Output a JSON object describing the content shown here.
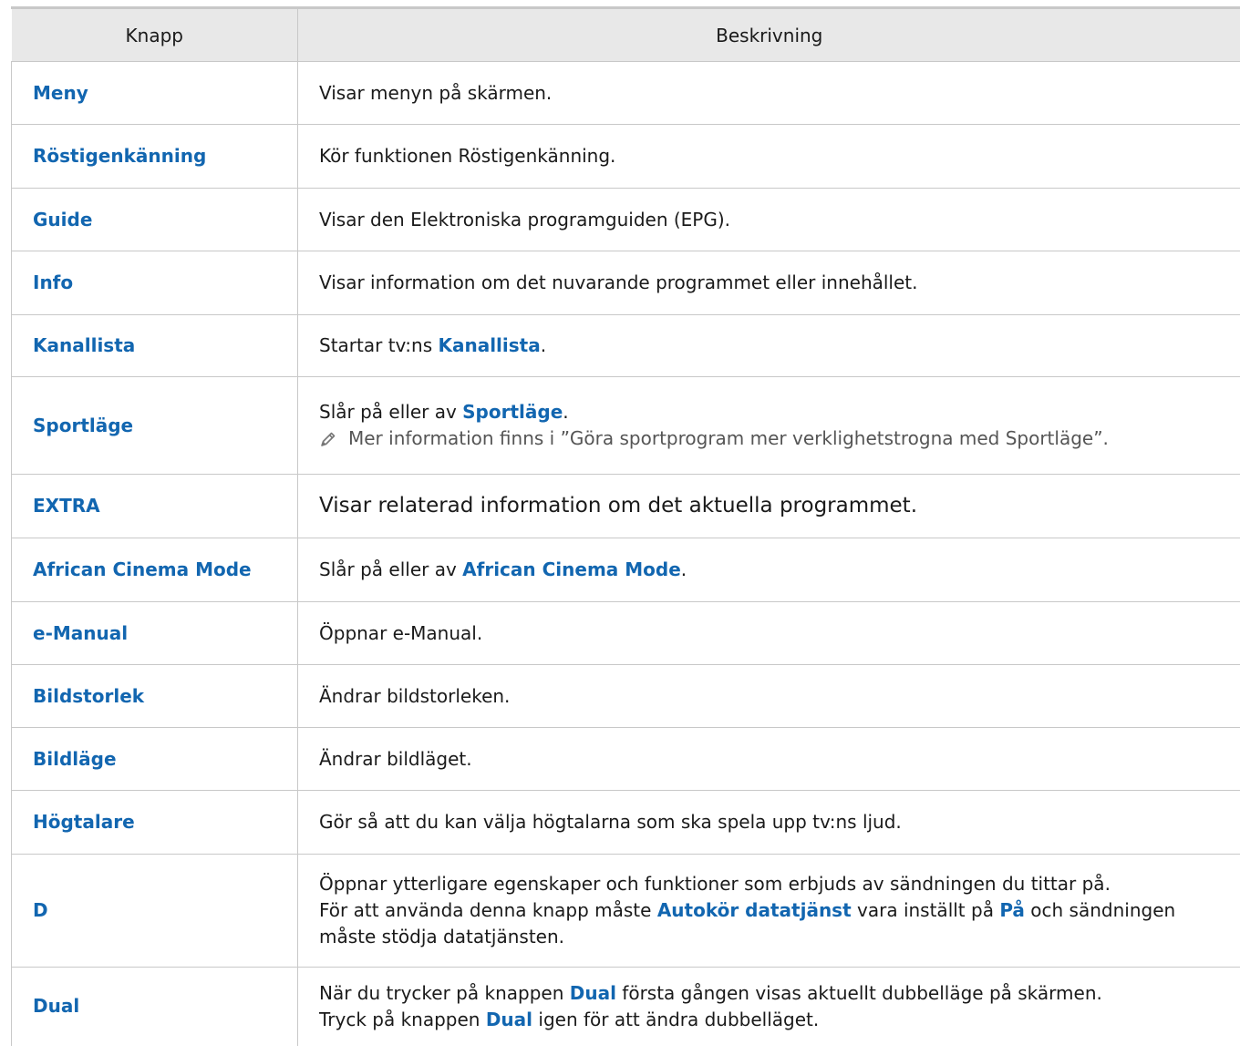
{
  "header": {
    "col_key": "Knapp",
    "col_desc": "Beskrivning"
  },
  "rows": [
    {
      "key": "Meny",
      "desc": "Visar menyn på skärmen."
    },
    {
      "key": "Röstigenkänning",
      "desc": "Kör funktionen Röstigenkänning."
    },
    {
      "key": "Guide",
      "desc": "Visar den Elektroniska programguiden (EPG)."
    },
    {
      "key": "Info",
      "desc": "Visar information om det nuvarande programmet eller innehållet."
    },
    {
      "key": "Kanallista",
      "desc_pre": "Startar tv:ns ",
      "desc_kw": "Kanallista",
      "desc_post": "."
    },
    {
      "key": "Sportläge",
      "desc_pre": "Slår på eller av ",
      "desc_kw": "Sportläge",
      "desc_post": ".",
      "note": "Mer information finns i ”Göra sportprogram mer verklighetstrogna med Sportläge”."
    },
    {
      "key": "EXTRA",
      "desc": "Visar relaterad information om det aktuella programmet."
    },
    {
      "key": "African Cinema Mode",
      "desc_pre": "Slår på eller av ",
      "desc_kw": "African Cinema Mode",
      "desc_post": "."
    },
    {
      "key": "e-Manual",
      "desc": "Öppnar e-Manual."
    },
    {
      "key": "Bildstorlek",
      "desc": "Ändrar bildstorleken."
    },
    {
      "key": "Bildläge",
      "desc": "Ändrar bildläget."
    },
    {
      "key": "Högtalare",
      "desc": "Gör så att du kan välja högtalarna som ska spela upp tv:ns ljud."
    },
    {
      "key": "D",
      "line1": "Öppnar ytterligare egenskaper och funktioner som erbjuds av sändningen du tittar på.",
      "line2_pre": "För att använda denna knapp måste ",
      "line2_kw1": "Autokör datatjänst",
      "line2_mid": " vara inställt på ",
      "line2_kw2": "På",
      "line2_post": " och sändningen",
      "line3": "måste stödja datatjänsten."
    },
    {
      "key": "Dual",
      "line1_pre": "När du trycker på knappen ",
      "line1_kw": "Dual",
      "line1_post": " första gången visas aktuellt dubbelläge på skärmen.",
      "line2_pre": "Tryck på knappen ",
      "line2_kw": "Dual",
      "line2_post": " igen för att ändra dubbelläget."
    }
  ],
  "icons": {
    "note_icon": "pencil-icon"
  },
  "colors": {
    "keyword": "#1266b0",
    "header_bg": "#e8e8e8",
    "border": "#c8c8c8"
  }
}
